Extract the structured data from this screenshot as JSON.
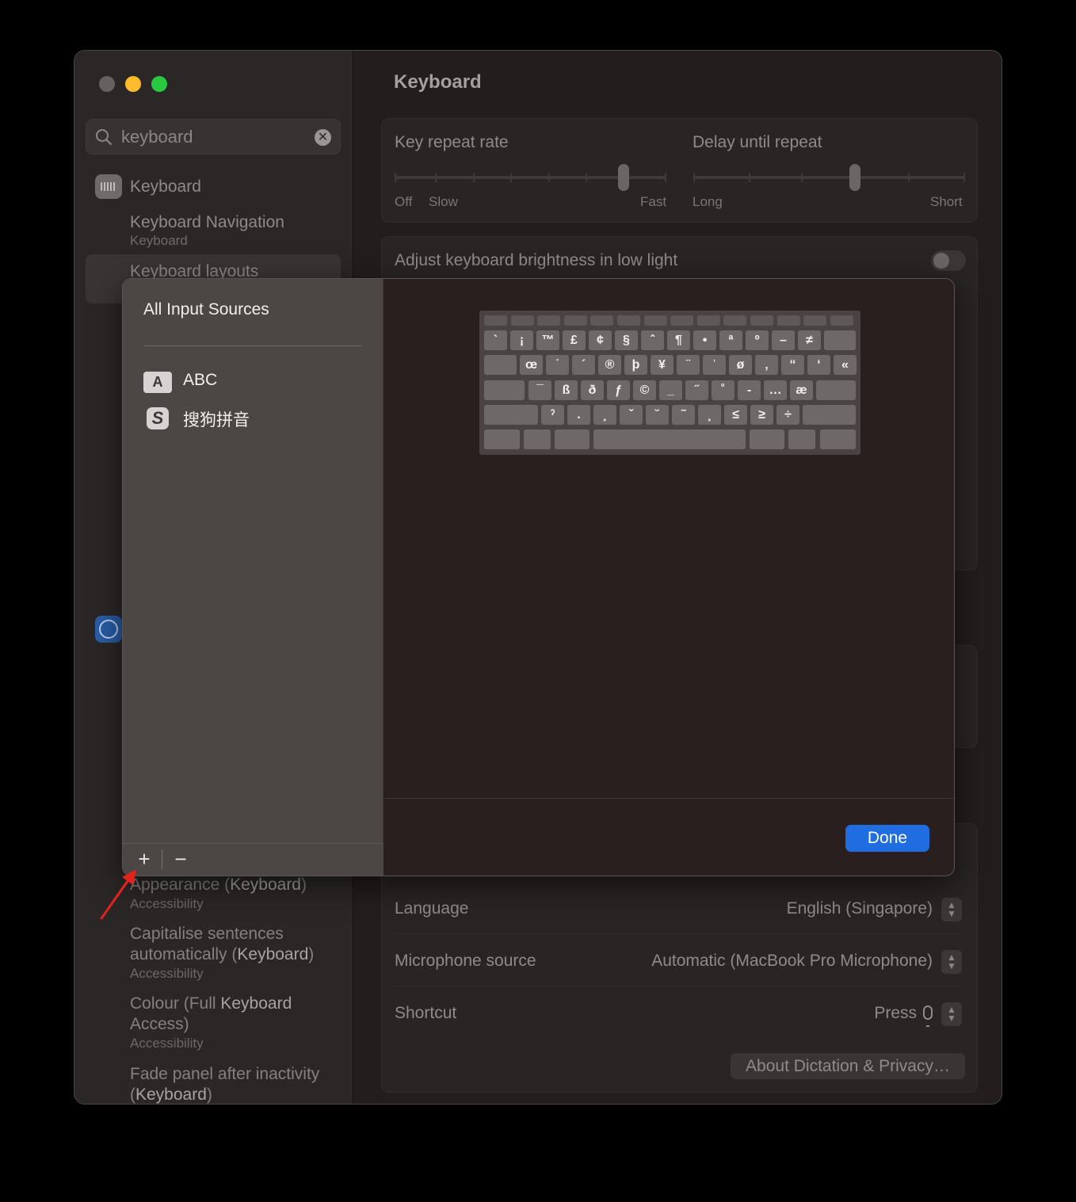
{
  "window": {
    "title": "Keyboard",
    "search": {
      "value": "keyboard",
      "clear_icon": "clear-circle-icon"
    },
    "sidebar": {
      "top_item": {
        "label": "Keyboard",
        "icon": "keyboard-icon"
      },
      "result_keyboard_navigation": {
        "label": "Keyboard Navigation",
        "sub": "Keyboard"
      },
      "result_keyboard_layouts": {
        "label": "Keyboard layouts"
      },
      "accessibility_icon": "accessibility-icon",
      "results": [
        {
          "pre": "Appearance (",
          "bold": "Keyboard",
          "post": ")",
          "sub": "Accessibility"
        },
        {
          "pre": "Capitalise sentences automatically (",
          "bold": "Keyboard",
          "post": ")",
          "sub": "Accessibility"
        },
        {
          "pre": "Colour (Full ",
          "bold": "Keyboard",
          "post": " Access)",
          "sub": "Accessibility"
        },
        {
          "pre": "Fade panel after inactivity (",
          "bold": "Keyboard",
          "post": ")",
          "sub": ""
        }
      ]
    },
    "settings": {
      "key_repeat_rate": {
        "label": "Key repeat rate",
        "min": "Off",
        "min2": "Slow",
        "max": "Fast",
        "level": 0.92
      },
      "delay_until_repeat": {
        "label": "Delay until repeat",
        "min": "Long",
        "max": "Short",
        "level": 0.6
      },
      "adjust_brightness": {
        "label": "Adjust keyboard brightness in low light",
        "on": false
      },
      "dictation": {
        "language_label": "Language",
        "language_value": "English (Singapore)",
        "microphone_label": "Microphone source",
        "microphone_value": "Automatic (MacBook Pro Microphone)",
        "shortcut_label": "Shortcut",
        "shortcut_value": "Press",
        "about_button": "About Dictation & Privacy…"
      }
    }
  },
  "sheet": {
    "heading": "All Input Sources",
    "sources": [
      {
        "badge": "A",
        "name": "ABC"
      },
      {
        "badge": "S",
        "name": "搜狗拼音"
      }
    ],
    "add_label": "+",
    "remove_label": "−",
    "done_label": "Done",
    "keyboard_rows": [
      [
        "`",
        "¡",
        "™",
        "£",
        "¢",
        "§",
        "ˆ",
        "¶",
        "•",
        "ª",
        "º",
        "–",
        "≠"
      ],
      [
        "œ",
        "˙",
        "´",
        "®",
        "þ",
        "¥",
        "¨",
        "ˈ",
        "ø",
        "‚",
        "“",
        "‘",
        "«"
      ],
      [
        "¯",
        "ß",
        "ð",
        "ƒ",
        "©",
        "_",
        "˝",
        "˚",
        "-",
        "…",
        "æ"
      ],
      [
        "ˀ",
        ".",
        "¸",
        "ˇ",
        "˘",
        "˜",
        "¸",
        "≤",
        "≥",
        "÷"
      ]
    ]
  },
  "annotation": {
    "color": "#e0241b"
  }
}
